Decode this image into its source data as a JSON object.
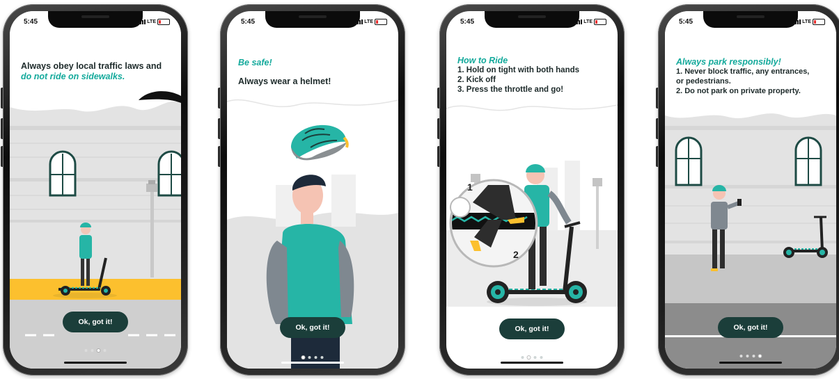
{
  "status_bar": {
    "time": "5:45",
    "network": "LTE"
  },
  "screens": [
    {
      "title_line1": "Always obey local traffic laws and",
      "title_accent": "do not ride on sidewalks.",
      "button": "Ok, got it!",
      "page_indicator": {
        "total": 4,
        "active": 3
      }
    },
    {
      "heading": "Be safe!",
      "body": "Always wear a helmet!",
      "button": "Ok, got it!",
      "page_indicator": {
        "total": 4,
        "active": 1
      }
    },
    {
      "heading": "How to Ride",
      "steps": [
        "1.  Hold on tight with both hands",
        "2.  Kick off",
        "3.  Press the throttle and go!"
      ],
      "callout_numbers": [
        "1",
        "2"
      ],
      "button": "Ok, got it!",
      "page_indicator": {
        "total": 4,
        "active": 2
      }
    },
    {
      "heading": "Always park responsibly!",
      "rules": [
        "1. Never block traffic, any entrances,",
        "or pedestrians.",
        "2. Do not park on private property."
      ],
      "button": "Ok, got it!",
      "page_indicator": {
        "total": 4,
        "active": 4
      }
    }
  ],
  "colors": {
    "accent": "#13a99b",
    "button": "#1b3e3a",
    "sidewalk": "#fcc02e",
    "helmet": "#26b5a6"
  }
}
